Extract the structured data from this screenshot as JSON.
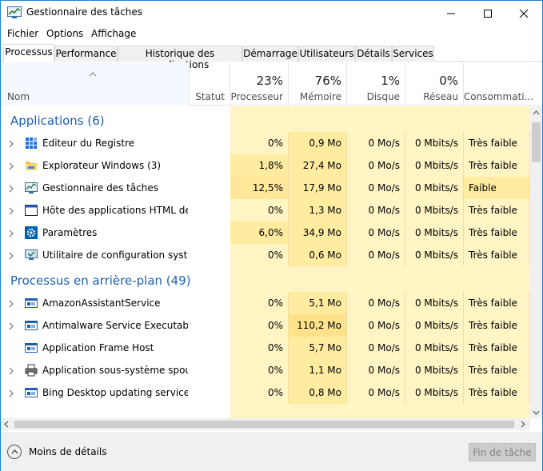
{
  "window": {
    "title": "Gestionnaire des tâches"
  },
  "menu": [
    "Fichier",
    "Options",
    "Affichage"
  ],
  "tabs": [
    {
      "label": "Processus",
      "active": true
    },
    {
      "label": "Performance"
    },
    {
      "label": "Historique des applications"
    },
    {
      "label": "Démarrage"
    },
    {
      "label": "Utilisateurs"
    },
    {
      "label": "Détails"
    },
    {
      "label": "Services"
    }
  ],
  "columns": {
    "name": {
      "label": "Nom"
    },
    "status": {
      "label": "Statut"
    },
    "cpu": {
      "label": "Processeur",
      "pct": "23%"
    },
    "memory": {
      "label": "Mémoire",
      "pct": "76%"
    },
    "disk": {
      "label": "Disque",
      "pct": "1%"
    },
    "network": {
      "label": "Réseau",
      "pct": "0%"
    },
    "power": {
      "label": "Consommati..."
    }
  },
  "groups": [
    {
      "title": "Applications (6)",
      "rows": [
        {
          "name": "Éditeur du Registre",
          "icon": "registry-icon",
          "cpu": "0%",
          "mem": "0,9 Mo",
          "disk": "0 Mo/s",
          "net": "0 Mbits/s",
          "power": "Très faible"
        },
        {
          "name": "Explorateur Windows (3)",
          "icon": "folder-icon",
          "cpu": "1,8%",
          "mem": "27,4 Mo",
          "disk": "0 Mo/s",
          "net": "0 Mbits/s",
          "power": "Très faible"
        },
        {
          "name": "Gestionnaire des tâches",
          "icon": "task-manager-icon",
          "cpu": "12,5%",
          "mem": "17,9 Mo",
          "disk": "0 Mo/s",
          "net": "0 Mbits/s",
          "power": "Faible"
        },
        {
          "name": "Hôte des applications HTML de ...",
          "icon": "window-app-icon",
          "cpu": "0%",
          "mem": "1,3 Mo",
          "disk": "0 Mo/s",
          "net": "0 Mbits/s",
          "power": "Très faible"
        },
        {
          "name": "Paramètres",
          "icon": "gear-icon",
          "cpu": "6,0%",
          "mem": "34,9 Mo",
          "disk": "0 Mo/s",
          "net": "0 Mbits/s",
          "power": "Très faible"
        },
        {
          "name": "Utilitaire de configuration systè...",
          "icon": "system-config-icon",
          "cpu": "0%",
          "mem": "0,6 Mo",
          "disk": "0 Mo/s",
          "net": "0 Mbits/s",
          "power": "Très faible"
        }
      ]
    },
    {
      "title": "Processus en arrière-plan (49)",
      "rows": [
        {
          "name": "AmazonAssistantService",
          "icon": "service-icon",
          "cpu": "0%",
          "mem": "5,1 Mo",
          "disk": "0 Mo/s",
          "net": "0 Mbits/s",
          "power": "Très faible"
        },
        {
          "name": "Antimalware Service Executable",
          "icon": "service-icon",
          "cpu": "0%",
          "mem": "110,2 Mo",
          "disk": "0 Mo/s",
          "net": "0 Mbits/s",
          "power": "Très faible"
        },
        {
          "name": "Application Frame Host",
          "icon": "service-icon",
          "cpu": "0%",
          "mem": "5,7 Mo",
          "disk": "0 Mo/s",
          "net": "0 Mbits/s",
          "power": "Très faible"
        },
        {
          "name": "Application sous-système spoul...",
          "icon": "printer-icon",
          "cpu": "0%",
          "mem": "1,1 Mo",
          "disk": "0 Mo/s",
          "net": "0 Mbits/s",
          "power": "Très faible"
        },
        {
          "name": "Bing Desktop updating service (...",
          "icon": "service-icon",
          "cpu": "0%",
          "mem": "0,8 Mo",
          "disk": "0 Mo/s",
          "net": "0 Mbits/s",
          "power": "Très faible"
        }
      ]
    }
  ],
  "footer": {
    "less_details": "Moins de détails",
    "end_task": "Fin de tâche"
  },
  "colors": {
    "accent": "#1e5fb4",
    "cell_light": "#fff4c4",
    "cell_mid": "#ffeca0",
    "cell_strong": "#ffe79a"
  }
}
